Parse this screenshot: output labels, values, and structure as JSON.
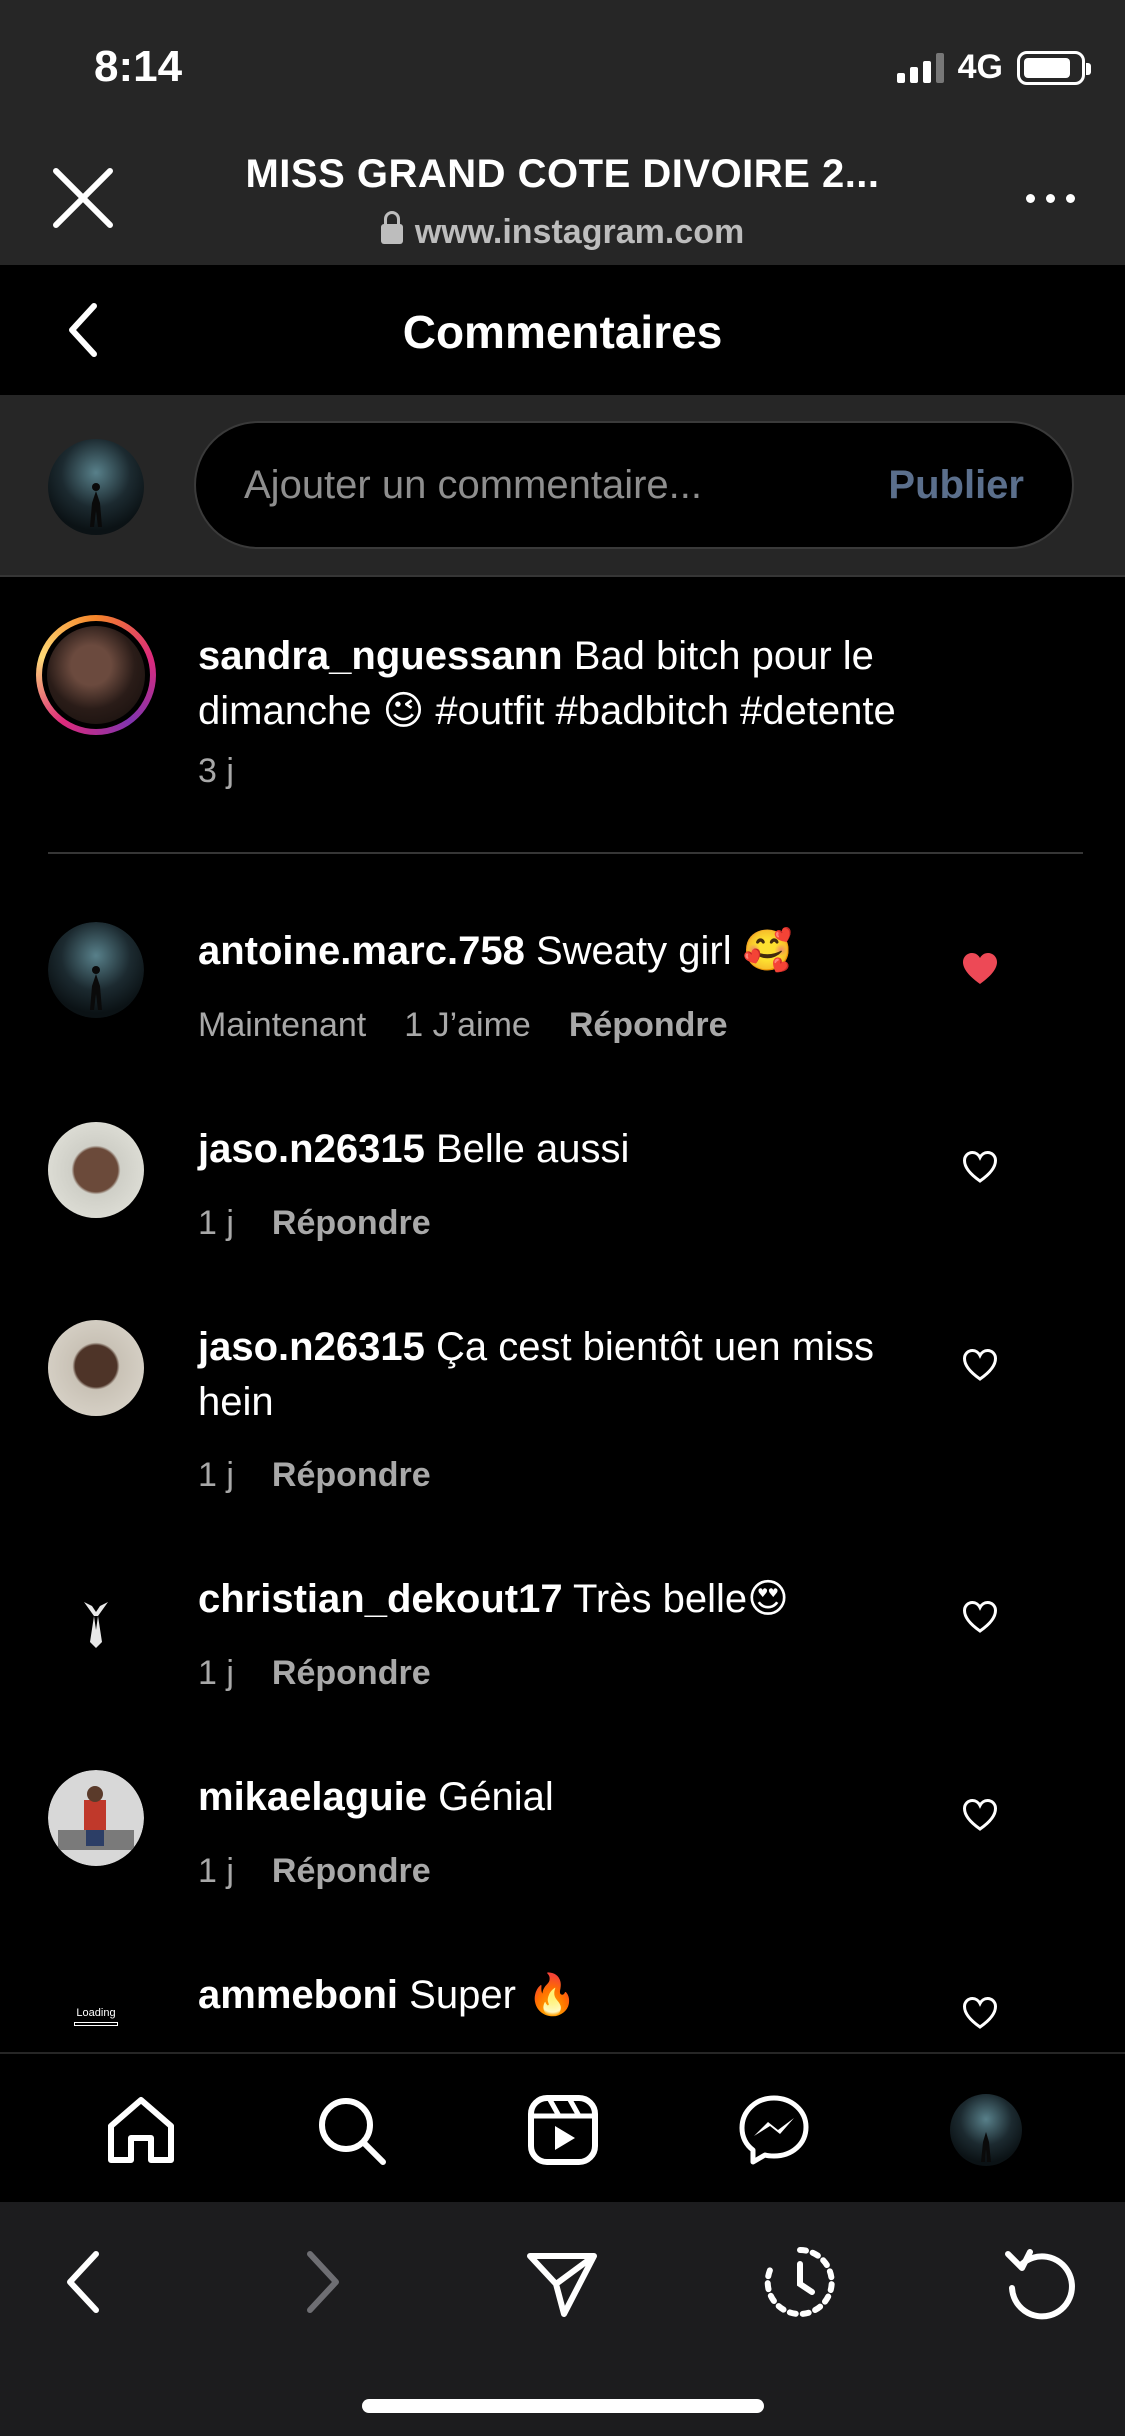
{
  "status_bar": {
    "time": "8:14",
    "network": "4G"
  },
  "browser_header": {
    "page_title": "MISS GRAND COTE DIVOIRE 2...",
    "url": "www.instagram.com"
  },
  "ig_header": {
    "title": "Commentaires"
  },
  "composer": {
    "placeholder": "Ajouter un commentaire...",
    "publish_label": "Publier"
  },
  "caption": {
    "username": "sandra_nguessann",
    "text_part1": "Bad bitch pour le dimanche",
    "emoji": "😉",
    "text_part2": "#outfit #badbitch #detente",
    "time": "3 j"
  },
  "comments": [
    {
      "username": "antoine.marc.758",
      "text": "Sweaty girl",
      "emoji": "🥰",
      "time": "Maintenant",
      "likes": "1 J’aime",
      "reply": "Répondre",
      "liked": true
    },
    {
      "username": "jaso.n26315",
      "text": "Belle aussi",
      "emoji": "",
      "time": "1 j",
      "reply": "Répondre",
      "liked": false
    },
    {
      "username": "jaso.n26315",
      "text": "Ça cest bientôt uen miss hein",
      "emoji": "",
      "time": "1 j",
      "reply": "Répondre",
      "liked": false
    },
    {
      "username": "christian_dekout17",
      "text": "Très belle",
      "emoji": "😍",
      "time": "1 j",
      "reply": "Répondre",
      "liked": false
    },
    {
      "username": "mikaelaguie",
      "text": "Génial",
      "emoji": "",
      "time": "1 j",
      "reply": "Répondre",
      "liked": false
    },
    {
      "username": "ammeboni",
      "text": "Super",
      "emoji": "🔥",
      "loading_label": "Loading",
      "liked": false
    }
  ],
  "tabbar": {
    "items": [
      "home-icon",
      "search-icon",
      "reels-icon",
      "messenger-icon",
      "profile-avatar"
    ]
  },
  "browser_toolbar": {
    "items": [
      "back-arrow-icon",
      "forward-arrow-icon",
      "share-icon",
      "history-icon",
      "reload-icon"
    ]
  },
  "colors": {
    "like_red": "#ed4956",
    "publish_muted": "#5b6f8c",
    "header_bg": "#262626"
  }
}
